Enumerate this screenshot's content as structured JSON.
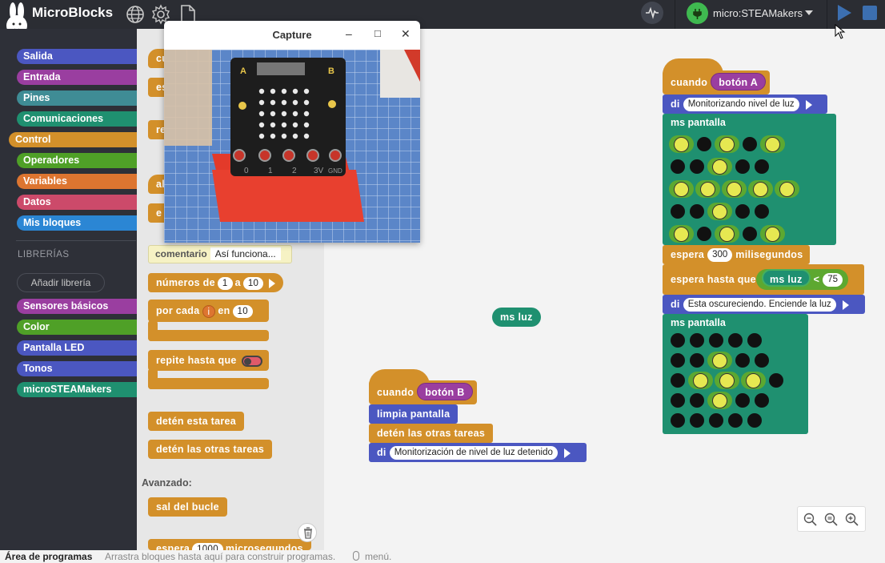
{
  "app": {
    "title": "MicroBlocks"
  },
  "topbar": {
    "icons": [
      "globe-icon",
      "gear-icon",
      "file-icon"
    ],
    "device_name": "micro:STEAMakers",
    "colors": {
      "run": "#3c6fb0",
      "device": "#3fb950"
    }
  },
  "sidebar": {
    "categories": [
      {
        "label": "Salida",
        "color": "#4b57c1"
      },
      {
        "label": "Entrada",
        "color": "#9a3ea0"
      },
      {
        "label": "Pines",
        "color": "#3f8c95"
      },
      {
        "label": "Comunicaciones",
        "color": "#1f9070"
      },
      {
        "label": "Control",
        "color": "#d3902a"
      },
      {
        "label": "Operadores",
        "color": "#4fa027"
      },
      {
        "label": "Variables",
        "color": "#dd7530"
      },
      {
        "label": "Datos",
        "color": "#cc4a6a"
      },
      {
        "label": "Mis bloques",
        "color": "#2b86d4"
      }
    ],
    "libraries_label": "LIBRERÍAS",
    "add_library": "Añadir librería",
    "libraries": [
      {
        "label": "Sensores básicos",
        "color": "#9a3ea0"
      },
      {
        "label": "Color",
        "color": "#4fa027"
      },
      {
        "label": "Pantalla LED",
        "color": "#4b57c1"
      },
      {
        "label": "Tonos",
        "color": "#4b57c1"
      },
      {
        "label": "microSTEAMakers",
        "color": "#1f9070"
      }
    ]
  },
  "palette": {
    "partial_blocks": [
      "cu",
      "es",
      "re",
      "al",
      "e"
    ],
    "comment": {
      "label": "comentario",
      "value": "Así funciona..."
    },
    "numbers": {
      "label": "números de",
      "from": "1",
      "to_label": "a",
      "to": "10"
    },
    "for_each": {
      "label": "por cada",
      "var": "i",
      "in_label": "en",
      "value": "10"
    },
    "repeat_until": "repite hasta que",
    "stop_this": "detén esta tarea",
    "stop_others": "detén las otras tareas",
    "advanced_label": "Avanzado:",
    "exit_loop": "sal del bucle",
    "wait_micro": {
      "label": "espera",
      "value": "1000",
      "unit": "microsegundos"
    }
  },
  "script": {
    "scriptA": {
      "when": "cuando",
      "button": "botón A",
      "say1_label": "di",
      "say1_text": "Monitorizando nivel de luz",
      "display1_label": "ms pantalla",
      "display1_grid": [
        [
          1,
          0,
          1,
          0,
          1
        ],
        [
          0,
          0,
          1,
          0,
          0
        ],
        [
          1,
          1,
          1,
          1,
          1
        ],
        [
          0,
          0,
          1,
          0,
          0
        ],
        [
          1,
          0,
          1,
          0,
          1
        ]
      ],
      "wait_label": "espera",
      "wait_value": "300",
      "wait_unit": "milisegundos",
      "wait_until_label": "espera hasta que",
      "light_reporter": "ms luz",
      "op": "<",
      "threshold": "75",
      "say2_label": "di",
      "say2_text": "Esta oscureciendo. Enciende la luz",
      "display2_label": "ms pantalla",
      "display2_grid": [
        [
          0,
          0,
          0,
          0,
          0
        ],
        [
          0,
          0,
          1,
          0,
          0
        ],
        [
          0,
          1,
          1,
          1,
          0
        ],
        [
          0,
          0,
          1,
          0,
          0
        ],
        [
          0,
          0,
          0,
          0,
          0
        ]
      ]
    },
    "loose_reporter": "ms luz",
    "scriptB": {
      "when": "cuando",
      "button": "botón B",
      "clear": "limpia pantalla",
      "stop_others": "detén las otras tareas",
      "say_label": "di",
      "say_text": "Monitorización de nivel de luz detenido"
    }
  },
  "capture_window": {
    "title": "Capture",
    "minimize": "–",
    "maximize": "□",
    "close": "✕",
    "board_labels": [
      "A",
      "B",
      "0",
      "1",
      "2",
      "3V",
      "GND"
    ]
  },
  "statusbar": {
    "title": "Área de programas",
    "hint": "Arrastra bloques hasta aquí para construir programas.",
    "menu_hint": "menú."
  }
}
